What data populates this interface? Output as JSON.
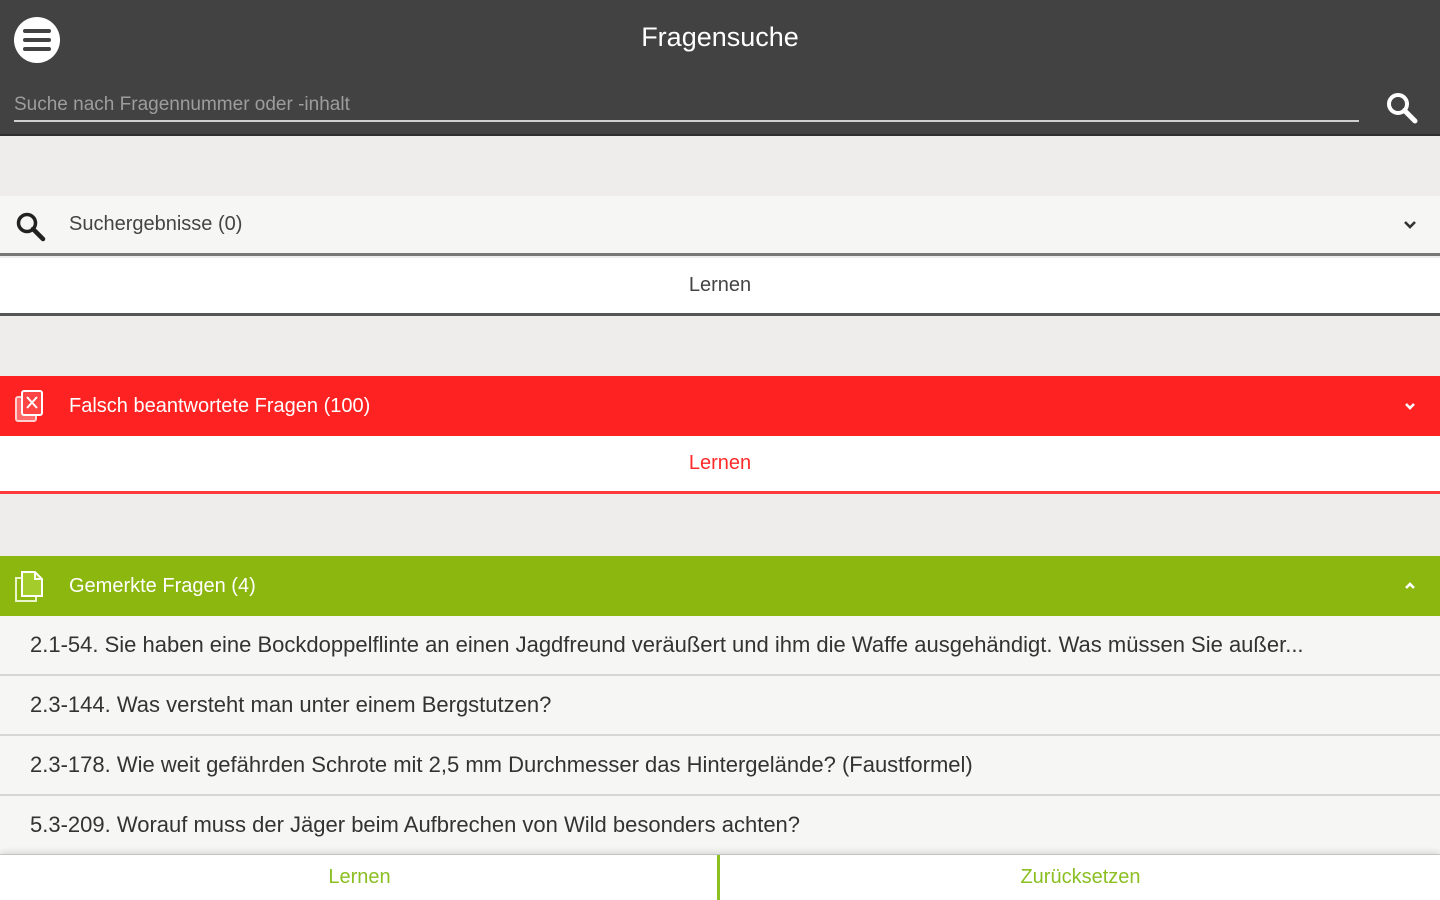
{
  "header": {
    "title": "Fragensuche",
    "search_placeholder": "Suche nach Fragennummer oder -inhalt",
    "search_value": ""
  },
  "search_section": {
    "title": "Suchergebnisse (0)",
    "learn_label": "Lernen",
    "color": "#f6f6f4"
  },
  "wrong_section": {
    "title": "Falsch beantwortete Fragen (100)",
    "learn_label": "Lernen",
    "color": "#ff2222"
  },
  "marked_section": {
    "title": "Gemerkte Fragen (4)",
    "color": "#8bb70e",
    "items": [
      "2.1-54. Sie haben eine Bockdoppelflinte an einen Jagdfreund veräußert und ihm die Waffe ausgehändigt. Was müssen  Sie außer...",
      "2.3-144. Was versteht man unter einem Bergstutzen?",
      "2.3-178. Wie weit gefährden Schrote mit 2,5 mm Durchmesser das Hintergelände? (Faustformel)",
      "5.3-209. Worauf muss der Jäger beim Aufbrechen von Wild besonders achten?"
    ]
  },
  "bottom_bar": {
    "learn_label": "Lernen",
    "reset_label": "Zurücksetzen",
    "accent": "#8bbf22"
  },
  "icons": [
    "menu-icon",
    "search-icon",
    "search-results-icon",
    "wrong-answers-icon",
    "bookmark-pages-icon",
    "chevron-down-icon",
    "chevron-up-icon"
  ]
}
